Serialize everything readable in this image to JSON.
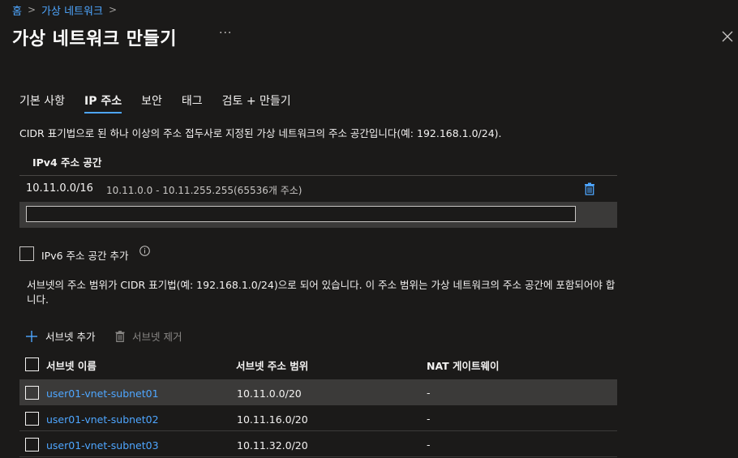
{
  "breadcrumb": {
    "home": "홈",
    "current": "가상 네트워크",
    "separator": ">"
  },
  "title": "가상 네트워크 만들기",
  "more_label": "···",
  "icons": {
    "close": "close-icon",
    "delete": "trash-icon",
    "info": "info-icon",
    "add": "plus-icon"
  },
  "colors": {
    "accent": "#4ea6ff",
    "background": "#1b1a19",
    "row_selected": "#3b3a39"
  },
  "tabs": [
    {
      "label": "기본 사항",
      "active": false
    },
    {
      "label": "IP 주소",
      "active": true
    },
    {
      "label": "보안",
      "active": false
    },
    {
      "label": "태그",
      "active": false
    },
    {
      "label": "검토 + 만들기",
      "active": false
    }
  ],
  "ip_description": "CIDR 표기법으로 된 하나 이상의 주소 접두사로 지정된 가상 네트워크의 주소 공간입니다(예: 192.168.1.0/24).",
  "ipv4": {
    "header": "IPv4 주소 공간",
    "entries": [
      {
        "cidr": "10.11.0.0/16",
        "range": "10.11.0.0 - 10.11.255.255(65536개 주소)"
      }
    ],
    "input_value": ""
  },
  "ipv6": {
    "label": "IPv6 주소 공간 추가",
    "checked": false
  },
  "subnet_description": "서브넷의 주소 범위가 CIDR 표기법(예: 192.168.1.0/24)으로 되어 있습니다. 이 주소 범위는 가상 네트워크의 주소 공간에 포함되어야 합니다.",
  "toolbar": {
    "add_label": "서브넷 추가",
    "remove_label": "서브넷 제거"
  },
  "subnet_table": {
    "headers": [
      "서브넷 이름",
      "서브넷 주소 범위",
      "NAT 게이트웨이"
    ],
    "rows": [
      {
        "name": "user01-vnet-subnet01",
        "range": "10.11.0.0/20",
        "nat": "-"
      },
      {
        "name": "user01-vnet-subnet02",
        "range": "10.11.16.0/20",
        "nat": "-"
      },
      {
        "name": "user01-vnet-subnet03",
        "range": "10.11.32.0/20",
        "nat": "-"
      }
    ]
  }
}
